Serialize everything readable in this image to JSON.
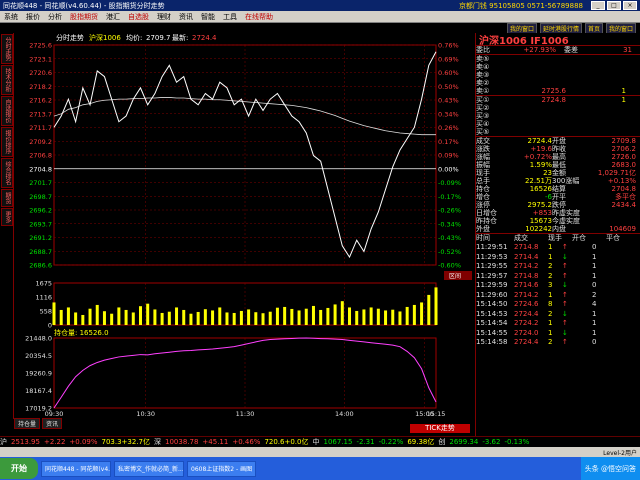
{
  "window": {
    "title": "同花顺448 - 同花顺(v4.60.44) - 股指期货分时走势",
    "right_text": "京都门钱 95105805 0571-56789888",
    "btn_min": "_",
    "btn_max": "□",
    "btn_close": "×"
  },
  "menu": [
    "系统",
    "报价",
    "分析",
    "股指期货",
    "港汇",
    "自选股",
    "理财",
    "资讯",
    "智能",
    "工具",
    "在线帮助"
  ],
  "nav": [
    "我的窗口",
    "延时港股行情",
    "首页",
    "我的窗口"
  ],
  "left_tabs": [
    "分时走势",
    "技术分析",
    "自选报价",
    "报价排序",
    "综合排名",
    "期货",
    "更多"
  ],
  "chart_data": {
    "type": "line",
    "title": "分时走势",
    "header": {
      "name": "沪深1006",
      "avg_label": "均价:",
      "avg": "2709.7",
      "last_label": "最新:",
      "last": "2724.4"
    },
    "prev_close": 2704.8,
    "ylim": [
      2686.6,
      2725.6
    ],
    "price_ticks": [
      "2725.6",
      "2723.1",
      "2720.6",
      "2718.2",
      "2716.2",
      "2713.7",
      "2711.7",
      "2709.2",
      "2706.8",
      "2704.8",
      "2701.7",
      "2698.7",
      "2696.2",
      "2693.7",
      "2691.2",
      "2688.7",
      "2686.6"
    ],
    "pct_ticks": [
      "0.76%",
      "0.69%",
      "0.60%",
      "0.50%",
      "0.43%",
      "0.34%",
      "0.26%",
      "0.17%",
      "0.09%",
      "0.00%",
      "-0.09%",
      "-0.17%",
      "-0.26%",
      "-0.34%",
      "-0.43%",
      "-0.52%",
      "-0.60%"
    ],
    "x_ticks": [
      "09:30",
      "10:30",
      "11:30",
      "14:00",
      "15:00",
      "15:15"
    ],
    "price": [
      2711,
      2713,
      2716,
      2712,
      2718,
      2715,
      2721,
      2720,
      2716,
      2712,
      2713,
      2716,
      2718,
      2715,
      2717,
      2720,
      2722,
      2719,
      2720,
      2716,
      2715,
      2717,
      2716,
      2719,
      2718,
      2715,
      2716,
      2713,
      2716,
      2714,
      2716,
      2717,
      2715,
      2713,
      2712,
      2710,
      2706,
      2705,
      2700,
      2695,
      2690,
      2688,
      2691,
      2689,
      2693,
      2696,
      2700,
      2704,
      2707,
      2709,
      2711,
      2716,
      2722,
      2724.4
    ],
    "avg": [
      2713,
      2713.4,
      2714.2,
      2714.5,
      2715,
      2715.2,
      2715.6,
      2715.8,
      2715.9,
      2716,
      2716,
      2716.1,
      2716.1,
      2716.2,
      2716.2,
      2716.3,
      2716.3,
      2716.2,
      2716.2,
      2716.1,
      2716,
      2716,
      2715.9,
      2715.9,
      2715.8,
      2715.7,
      2715.6,
      2715.5,
      2715.4,
      2715.3,
      2715.2,
      2715.1,
      2715,
      2714.9,
      2714.7,
      2714.5,
      2714.2,
      2713.9,
      2713.5,
      2713.1,
      2712.6,
      2712.1,
      2711.7,
      2711.3,
      2711,
      2710.7,
      2710.4,
      2710.2,
      2710,
      2709.9,
      2709.8,
      2709.7,
      2709.7,
      2709.7
    ],
    "volume_ticks": [
      "1675",
      "1116",
      "558",
      "0"
    ],
    "volume": [
      900,
      600,
      700,
      500,
      400,
      650,
      800,
      550,
      450,
      700,
      600,
      500,
      750,
      850,
      620,
      480,
      530,
      700,
      600,
      450,
      520,
      630,
      580,
      700,
      500,
      480,
      560,
      620,
      510,
      470,
      530,
      690,
      720,
      640,
      580,
      650,
      760,
      600,
      680,
      820,
      950,
      700,
      560,
      620,
      700,
      650,
      580,
      610,
      540,
      720,
      800,
      900,
      1200,
      1500
    ],
    "oi_label": "持仓量: 16526.0",
    "oi_ticks": [
      "21448.0",
      "20354.5",
      "19260.9",
      "18167.4",
      "17019.2"
    ],
    "oi": [
      17019,
      17700,
      18400,
      19000,
      19400,
      19700,
      19900,
      20050,
      20150,
      20250,
      20300,
      20350,
      20400,
      20380,
      20450,
      20500,
      20550,
      20600,
      20640,
      20660,
      20700,
      20720,
      20750,
      20800,
      20850,
      20900,
      21000,
      21100,
      21200,
      21300,
      21350,
      21380,
      21400,
      21420,
      21440,
      21448,
      21430,
      21410,
      21400,
      21380,
      21350,
      21300,
      21250,
      21200,
      21150,
      21100,
      21050,
      21000,
      20900,
      20600,
      20200,
      19500,
      18300,
      17400
    ]
  },
  "right": {
    "title": "沪深1006 IF1006",
    "weibi": {
      "label": "委比",
      "value": "+27.93%",
      "wc_label": "委差",
      "wc": "31"
    },
    "sells": [
      {
        "l": "卖⑤",
        "p": "",
        "v": ""
      },
      {
        "l": "卖④",
        "p": "",
        "v": ""
      },
      {
        "l": "卖③",
        "p": "",
        "v": ""
      },
      {
        "l": "卖②",
        "p": "",
        "v": ""
      },
      {
        "l": "卖①",
        "p": "2725.6",
        "v": "1"
      }
    ],
    "buys": [
      {
        "l": "买①",
        "p": "2724.8",
        "v": "1"
      },
      {
        "l": "买②",
        "p": "",
        "v": ""
      },
      {
        "l": "买③",
        "p": "",
        "v": ""
      },
      {
        "l": "买④",
        "p": "",
        "v": ""
      },
      {
        "l": "买⑤",
        "p": "",
        "v": ""
      }
    ],
    "stats": [
      [
        "成交",
        "2724.4",
        "开盘",
        "2709.8"
      ],
      [
        "涨跌",
        "+19.6",
        "昨收",
        "2706.2"
      ],
      [
        "涨幅",
        "+0.72%",
        "最高",
        "2726.0"
      ],
      [
        "振幅",
        "1.59%",
        "最低",
        "2683.0"
      ],
      [
        "现手",
        "23",
        "金额",
        "1,029.71亿"
      ],
      [
        "总手",
        "22.51万",
        "300涨幅",
        "+0.13%"
      ],
      [
        "持仓",
        "16526",
        "结算",
        "2704.8"
      ],
      [
        "增仓",
        "-6",
        "开平",
        "多平仓"
      ],
      [
        "涨停",
        "2975.2",
        "跌停",
        "2434.4"
      ],
      [
        "日增仓",
        "+853",
        "昨虚实度",
        ""
      ],
      [
        "昨持仓",
        "15673",
        "今虚实度",
        ""
      ],
      [
        "外盘",
        "102242",
        "内盘",
        "104609"
      ]
    ],
    "trade_header": [
      "时间",
      "成交",
      "现手",
      "开仓",
      "平仓"
    ],
    "trades": [
      [
        "11:29:51",
        "2714.8",
        "1",
        "↑",
        "0"
      ],
      [
        "11:29:53",
        "2714.4",
        "1",
        "↓",
        "1"
      ],
      [
        "11:29:55",
        "2714.2",
        "2",
        "↑",
        "1"
      ],
      [
        "11:29:57",
        "2714.8",
        "2",
        "↑",
        "1"
      ],
      [
        "11:29:59",
        "2714.6",
        "3",
        "↓",
        "0"
      ],
      [
        "11:29:60",
        "2714.2",
        "1",
        "↑",
        "2"
      ],
      [
        "15:14:50",
        "2724.6",
        "8",
        "↑",
        "4"
      ],
      [
        "15:14:53",
        "2724.4",
        "2",
        "↓",
        "1"
      ],
      [
        "15:14:54",
        "2724.2",
        "1",
        "↑",
        "1"
      ],
      [
        "15:14:55",
        "2724.0",
        "1",
        "↓",
        "1"
      ],
      [
        "15:14:58",
        "2724.4",
        "2",
        "↑",
        "0"
      ]
    ]
  },
  "bottom_tabs": [
    "持仓量",
    "资讯"
  ],
  "tick_label": "TICK走势",
  "status": [
    {
      "t": "沪",
      "c": "wht"
    },
    {
      "t": "2513.95",
      "c": "red"
    },
    {
      "t": "+2.22",
      "c": "red"
    },
    {
      "t": "+0.09%",
      "c": "red"
    },
    {
      "t": "703.3+32.7亿",
      "c": "yel"
    },
    {
      "t": "深",
      "c": "wht"
    },
    {
      "t": "10038.78",
      "c": "red"
    },
    {
      "t": "+45.11",
      "c": "red"
    },
    {
      "t": "+0.46%",
      "c": "red"
    },
    {
      "t": "720.6+0.0亿",
      "c": "yel"
    },
    {
      "t": "中",
      "c": "wht"
    },
    {
      "t": "1067.15",
      "c": "grn"
    },
    {
      "t": "-2.31",
      "c": "grn"
    },
    {
      "t": "-0.22%",
      "c": "grn"
    },
    {
      "t": "69.38亿",
      "c": "yel"
    },
    {
      "t": "创",
      "c": "wht"
    },
    {
      "t": "2699.34",
      "c": "grn"
    },
    {
      "t": "-3.62",
      "c": "grn"
    },
    {
      "t": "-0.13%",
      "c": "grn"
    }
  ],
  "footer": "Level-2用户",
  "taskbar": {
    "start": "开始",
    "tasks": [
      "同花顺448 - 同花顺(v4...",
      "私密博文_作就必简_新...",
      "0608上证指数2 - 画图"
    ],
    "tray": "头条 @悟空问答"
  }
}
